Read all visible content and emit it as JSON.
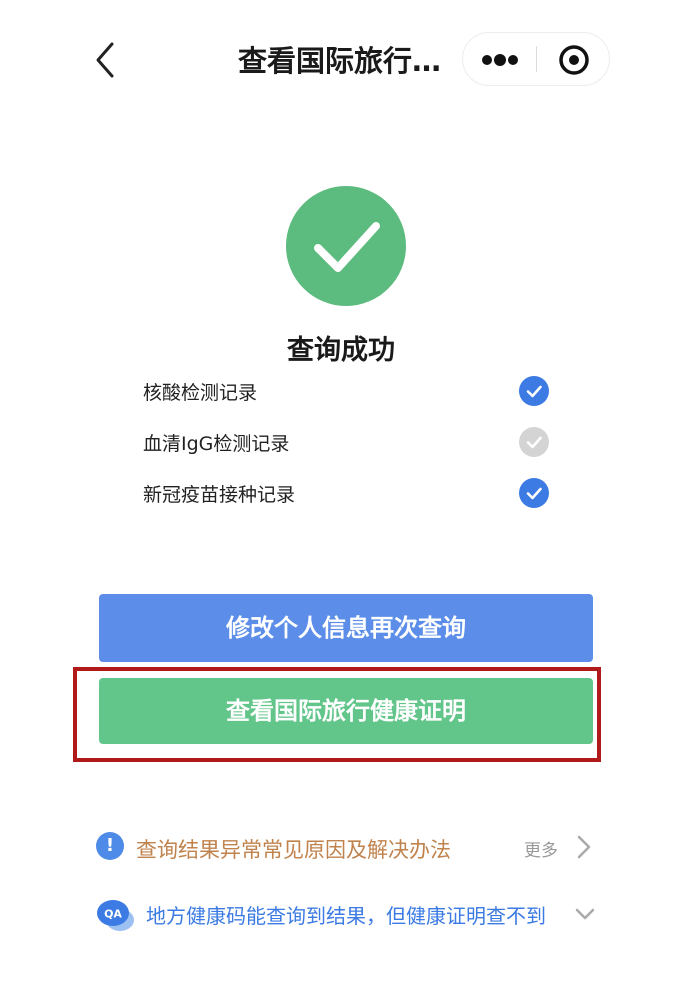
{
  "nav": {
    "title": "查看国际旅行…",
    "back_icon": "chevron-left-icon",
    "more_icon": "ellipsis-icon",
    "close_icon": "target-circle-icon"
  },
  "status": {
    "icon": "checkmark-icon",
    "title": "查询成功",
    "color": "#5cbb7e"
  },
  "records": [
    {
      "label": "核酸检测记录",
      "checked": true
    },
    {
      "label": "血清IgG检测记录",
      "checked": false
    },
    {
      "label": "新冠疫苗接种记录",
      "checked": true
    }
  ],
  "buttons": {
    "requery": "修改个人信息再次查询",
    "view_certificate": "查看国际旅行健康证明"
  },
  "faq": {
    "issue_text": "查询结果异常常见原因及解决办法",
    "more_label": "更多",
    "qa_icon_text": "QA",
    "qa_text": "地方健康码能查询到结果，但健康证明查不到"
  },
  "colors": {
    "primary_blue": "#5b8de9",
    "primary_green": "#62c58a",
    "highlight_red": "#b01a1a",
    "faq_orange": "#c0834d",
    "link_blue": "#3c7be3"
  }
}
